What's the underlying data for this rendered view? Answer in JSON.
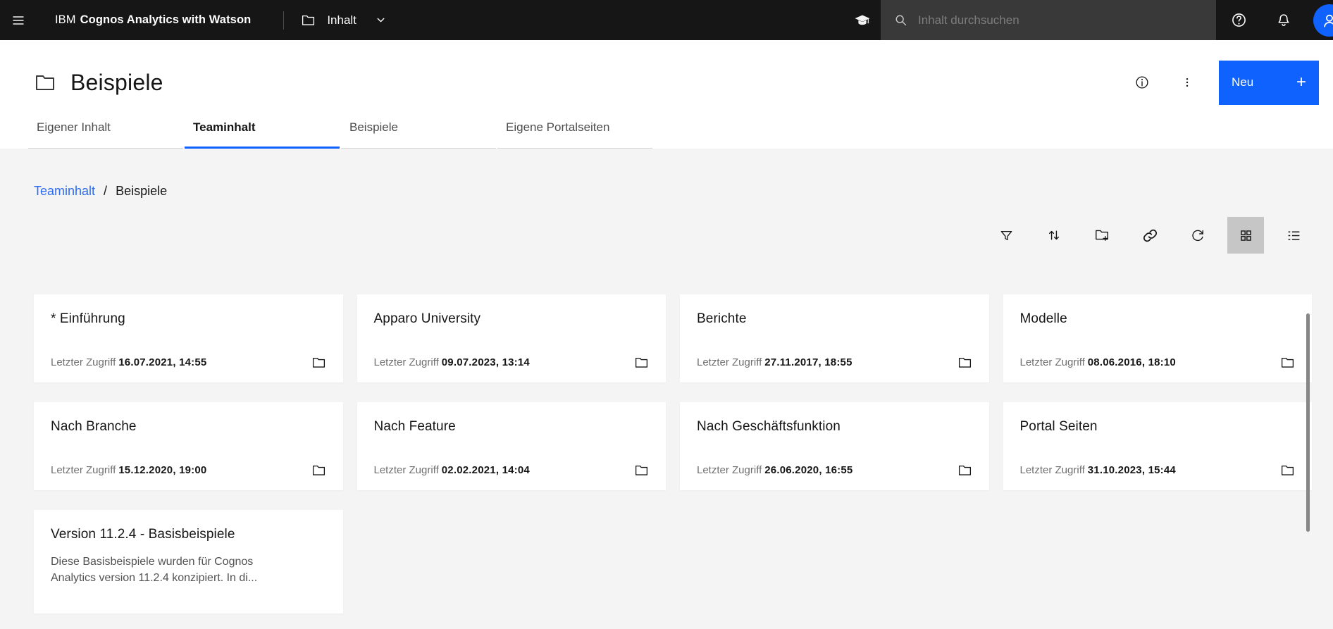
{
  "header": {
    "brand_prefix": "IBM",
    "brand_name": "Cognos Analytics with Watson",
    "nav_label": "Inhalt",
    "search_placeholder": "Inhalt durchsuchen"
  },
  "page": {
    "title": "Beispiele",
    "new_button_label": "Neu",
    "new_button_plus": "+"
  },
  "tabs": [
    {
      "label": "Eigener Inhalt",
      "active": false
    },
    {
      "label": "Teaminhalt",
      "active": true
    },
    {
      "label": "Beispiele",
      "active": false
    },
    {
      "label": "Eigene Portalseiten",
      "active": false
    }
  ],
  "breadcrumb": {
    "parent": "Teaminhalt",
    "separator": "/",
    "current": "Beispiele"
  },
  "toolbar": {
    "icons": [
      "filter",
      "sort",
      "new-folder",
      "link",
      "refresh",
      "grid-view",
      "list-view"
    ],
    "active_icon": "grid-view"
  },
  "cards": [
    {
      "title": "* Einführung",
      "meta_label": "Letzter Zugriff",
      "date": "16.07.2021, 14:55"
    },
    {
      "title": "Apparo University",
      "meta_label": "Letzter Zugriff",
      "date": "09.07.2023, 13:14"
    },
    {
      "title": "Berichte",
      "meta_label": "Letzter Zugriff",
      "date": "27.11.2017, 18:55"
    },
    {
      "title": "Modelle",
      "meta_label": "Letzter Zugriff",
      "date": "08.06.2016, 18:10"
    },
    {
      "title": "Nach Branche",
      "meta_label": "Letzter Zugriff",
      "date": "15.12.2020, 19:00"
    },
    {
      "title": "Nach Feature",
      "meta_label": "Letzter Zugriff",
      "date": "02.02.2021, 14:04"
    },
    {
      "title": "Nach Geschäftsfunktion",
      "meta_label": "Letzter Zugriff",
      "date": "26.06.2020, 16:55"
    },
    {
      "title": "Portal Seiten",
      "meta_label": "Letzter Zugriff",
      "date": "31.10.2023, 15:44"
    },
    {
      "title": "Version 11.2.4 - Basisbeispiele",
      "description": "Diese Basisbeispiele wurden für Cognos Analytics version 11.2.4 konzipiert. In di..."
    }
  ],
  "colors": {
    "accent_blue": "#0f62fe",
    "header_bg": "#161616",
    "search_bg": "#393939",
    "content_bg": "#f4f4f4",
    "link_blue": "#2d6bf2",
    "active_tool_bg": "#c6c6c6",
    "scrollbar": "#878787"
  }
}
